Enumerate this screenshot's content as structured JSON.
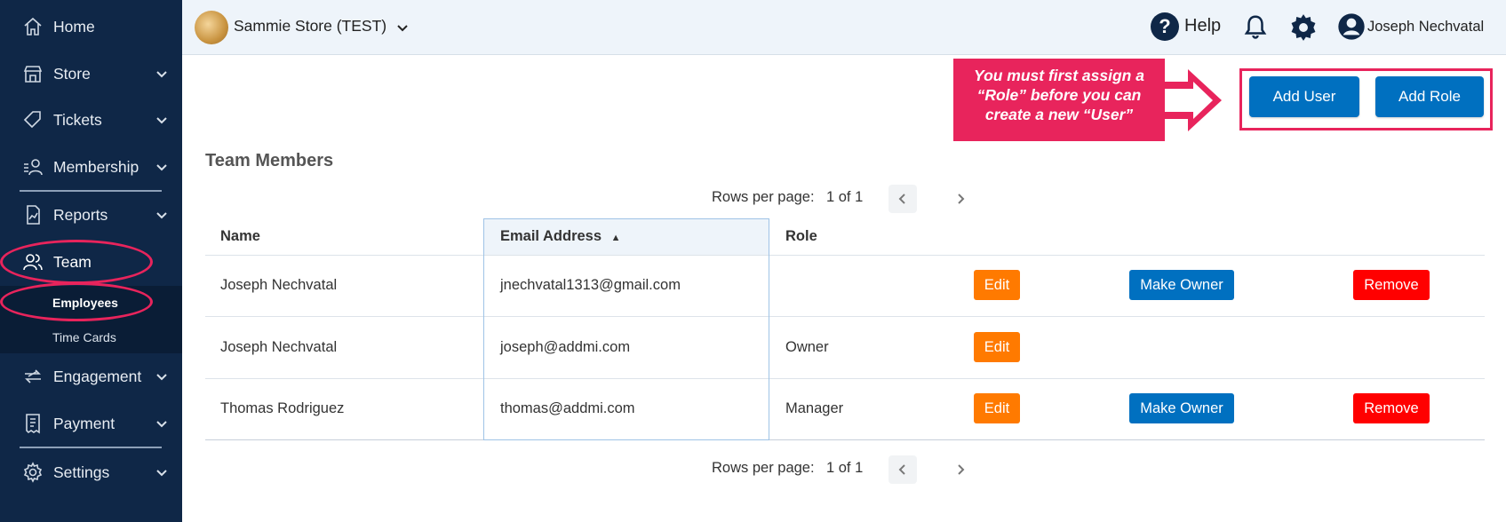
{
  "sidebar": {
    "items": [
      {
        "label": "Home",
        "icon": "home-icon"
      },
      {
        "label": "Store",
        "icon": "store-icon"
      },
      {
        "label": "Tickets",
        "icon": "ticket-icon"
      },
      {
        "label": "Membership",
        "icon": "membership-icon"
      },
      {
        "label": "Reports",
        "icon": "report-icon"
      },
      {
        "label": "Team",
        "icon": "team-icon"
      },
      {
        "label": "Engagement",
        "icon": "engagement-icon"
      },
      {
        "label": "Payment",
        "icon": "payment-icon"
      },
      {
        "label": "Settings",
        "icon": "gear-icon"
      }
    ],
    "team_sub": [
      {
        "label": "Employees",
        "active": true
      },
      {
        "label": "Time Cards",
        "active": false
      }
    ]
  },
  "header": {
    "store_name": "Sammie Store (TEST)",
    "help_label": "Help",
    "user_name": "Joseph Nechvatal"
  },
  "callout": {
    "line1": "You must first assign a",
    "line2": "“Role” before you can",
    "line3": "create a new “User”"
  },
  "actions": {
    "add_user": "Add User",
    "add_role": "Add Role"
  },
  "main": {
    "heading": "Team Members",
    "pager": {
      "rows_per_page_label": "Rows per page:",
      "page": "1 of 1"
    },
    "columns": {
      "name": "Name",
      "email": "Email Address",
      "role": "Role"
    },
    "rows": [
      {
        "name": "Joseph Nechvatal",
        "email": "jnechvatal1313@gmail.com",
        "role": "",
        "edit": "Edit",
        "make_owner": "Make Owner",
        "remove": "Remove"
      },
      {
        "name": "Joseph Nechvatal",
        "email": "joseph@addmi.com",
        "role": "Owner",
        "edit": "Edit"
      },
      {
        "name": "Thomas Rodriguez",
        "email": "thomas@addmi.com",
        "role": "Manager",
        "edit": "Edit",
        "make_owner": "Make Owner",
        "remove": "Remove"
      }
    ]
  },
  "colors": {
    "sidebar_bg": "#0f2747",
    "primary": "#0070c0",
    "edit": "#ff7a00",
    "remove": "#ff0000",
    "highlight": "#e8245c"
  }
}
